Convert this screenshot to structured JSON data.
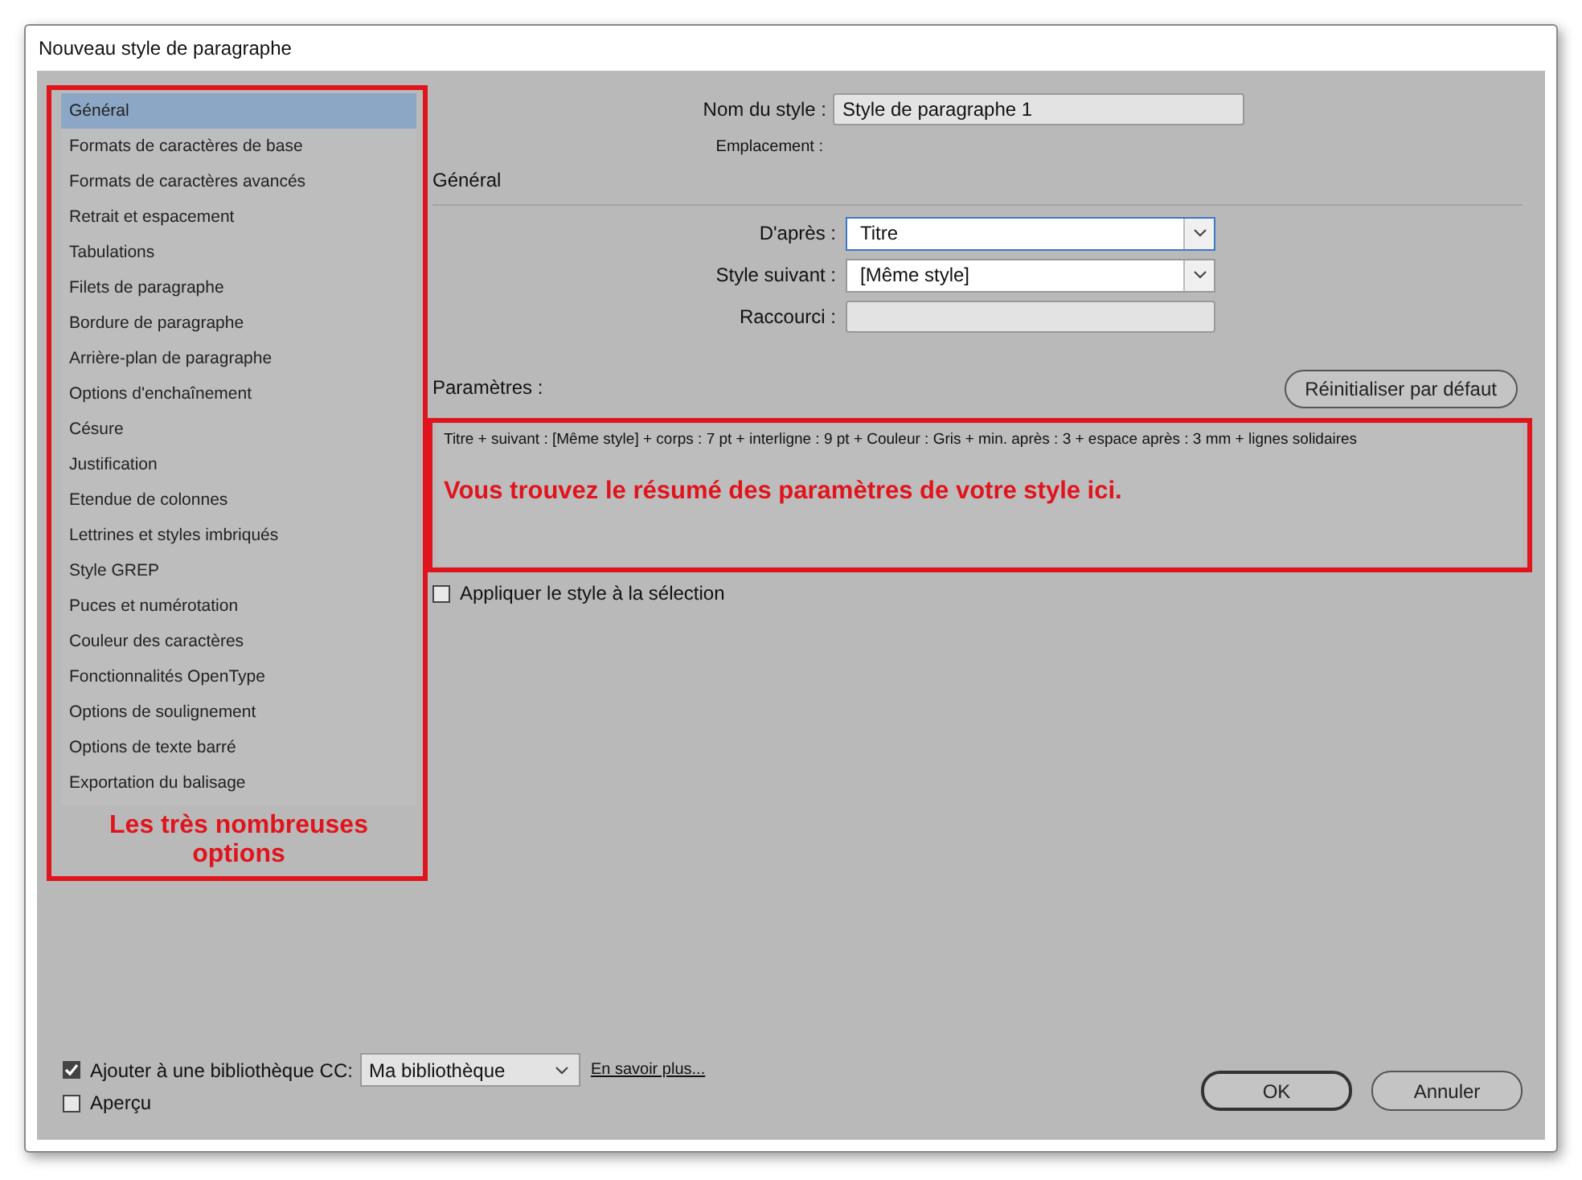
{
  "window": {
    "title": "Nouveau style de paragraphe"
  },
  "sidebar": {
    "items": [
      {
        "label": "Général",
        "selected": true
      },
      {
        "label": "Formats de caractères de base",
        "selected": false
      },
      {
        "label": "Formats de caractères avancés",
        "selected": false
      },
      {
        "label": "Retrait et espacement",
        "selected": false
      },
      {
        "label": "Tabulations",
        "selected": false
      },
      {
        "label": "Filets de paragraphe",
        "selected": false
      },
      {
        "label": "Bordure de paragraphe",
        "selected": false
      },
      {
        "label": "Arrière-plan de paragraphe",
        "selected": false
      },
      {
        "label": "Options d'enchaînement",
        "selected": false
      },
      {
        "label": "Césure",
        "selected": false
      },
      {
        "label": "Justification",
        "selected": false
      },
      {
        "label": "Etendue de colonnes",
        "selected": false
      },
      {
        "label": "Lettrines et styles imbriqués",
        "selected": false
      },
      {
        "label": "Style GREP",
        "selected": false
      },
      {
        "label": "Puces et numérotation",
        "selected": false
      },
      {
        "label": "Couleur des caractères",
        "selected": false
      },
      {
        "label": "Fonctionnalités OpenType",
        "selected": false
      },
      {
        "label": "Options de soulignement",
        "selected": false
      },
      {
        "label": "Options de texte barré",
        "selected": false
      },
      {
        "label": "Exportation du balisage",
        "selected": false
      }
    ],
    "annotation": "Les très nombreuses options"
  },
  "style_name": {
    "label": "Nom du style :",
    "value": "Style de paragraphe 1"
  },
  "location": {
    "label": "Emplacement :"
  },
  "section_title": "Général",
  "fields": [
    {
      "label": "D'après :",
      "value": "Titre",
      "kind": "dropdown",
      "focused": true
    },
    {
      "label": "Style suivant :",
      "value": "[Même style]",
      "kind": "dropdown",
      "focused": false
    },
    {
      "label": "Raccourci :",
      "kind": "text",
      "focused": false
    }
  ],
  "settings": {
    "label": "Paramètres :",
    "reset_button": "Réinitialiser par défaut",
    "summary": "Titre + suivant : [Même style] + corps : 7 pt + interligne : 9 pt + Couleur : Gris + min. après : 3 + espace après : 3 mm + lignes solidaires",
    "annotation": "Vous trouvez le résumé des paramètres de votre style ici."
  },
  "apply_to_selection": {
    "label": "Appliquer le style à la sélection",
    "checked": false
  },
  "cc_library": {
    "label": "Ajouter à une bibliothèque CC:",
    "checked": true,
    "value": "Ma bibliothèque",
    "link": "En savoir plus..."
  },
  "preview": {
    "label": "Aperçu",
    "checked": false
  },
  "buttons": [
    {
      "label": "OK",
      "kind": "default"
    },
    {
      "label": "Annuler",
      "kind": "normal"
    }
  ]
}
